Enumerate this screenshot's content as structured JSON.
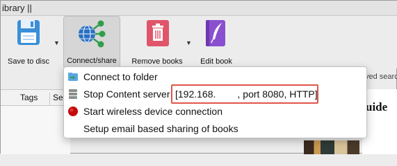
{
  "window": {
    "title_partial": "ibrary ||"
  },
  "toolbar": {
    "save_label": "Save to disc",
    "connect_label": "Connect/share",
    "remove_label": "Remove books",
    "edit_label": "Edit book"
  },
  "book_list": {
    "tags_label": "Tags",
    "series_label_partial": "Ser"
  },
  "right_panel": {
    "searches_partial": "ved searc",
    "guide_partial": "uide"
  },
  "menu": {
    "items": [
      {
        "label": "Connect to folder",
        "icon": "folder-icon"
      },
      {
        "label": "Stop Content server",
        "server_info": "[192.168.        , port 8080, HTTP]",
        "icon": "server-icon"
      },
      {
        "label": "Start wireless device connection",
        "icon": "red-dot-icon"
      },
      {
        "label": "Setup email based sharing of books"
      }
    ]
  },
  "colors": {
    "highlight_box": "#e05449",
    "save_icon": "#3a8fd8",
    "connect_icon": "#2f9e4a",
    "remove_icon": "#e0556a",
    "edit_icon": "#8a4fd0"
  }
}
